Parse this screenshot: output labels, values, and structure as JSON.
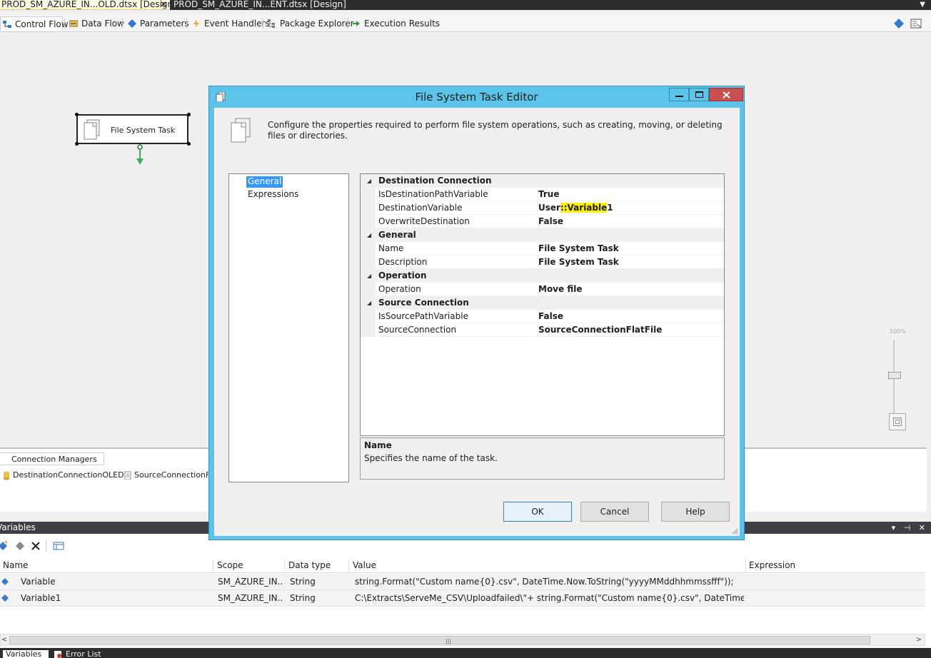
{
  "doc_tabs": [
    {
      "label": "PROD_SM_AZURE_IN...OLD.dtsx [Design]*",
      "close": "✕"
    },
    {
      "label": "PROD_SM_AZURE_IN...ENT.dtsx [Design]"
    }
  ],
  "doc_tabs_dropdown": "▼",
  "designer_tabs": [
    "Control Flow",
    "Data Flow",
    "Parameters",
    "Event Handlers",
    "Package Explorer",
    "Execution Results"
  ],
  "canvas": {
    "task_label": "File System Task",
    "zoom_label": "100%"
  },
  "connection_managers": {
    "tab_label": "Connection Managers",
    "items": [
      "DestinationConnectionOLEDB",
      "SourceConnectionFlatFile"
    ]
  },
  "variables_panel": {
    "title": "Variables",
    "title_controls": "▾ ⊣ ✕",
    "columns": [
      "Name",
      "Scope",
      "Data type",
      "Value",
      "Expression"
    ],
    "rows": [
      {
        "name": "Variable",
        "scope": "SM_AZURE_IN...",
        "type": "String",
        "value": "string.Format(\"Custom name{0}.csv\", DateTime.Now.ToString(\"yyyyMMddhhmmssfff\"));",
        "expression": ""
      },
      {
        "name": "Variable1",
        "scope": "SM_AZURE_IN...",
        "type": "String",
        "value": "C:\\Extracts\\ServeMe_CSV\\Uploadfailed\\\"+ string.Format(\"Custom name{0}.csv\", DateTime.Now.ToSt...",
        "expression": ""
      }
    ],
    "scroll_grip": "|||",
    "scroll_left": "<",
    "scroll_right": ">"
  },
  "bottom_tabs": [
    "Variables",
    "Error List"
  ],
  "dialog": {
    "title": "File System Task Editor",
    "description": "Configure the properties required to perform file system operations, such as creating, moving, or deleting files or directories.",
    "nav_items": [
      "General",
      "Expressions"
    ],
    "categories": [
      {
        "name": "Destination Connection",
        "props": [
          {
            "name": "IsDestinationPathVariable",
            "value": "True"
          },
          {
            "name": "DestinationVariable",
            "value_prefix": "User",
            "value_highlight": "::Variable",
            "value_suffix": "1"
          },
          {
            "name": "OverwriteDestination",
            "value": "False"
          }
        ]
      },
      {
        "name": "General",
        "props": [
          {
            "name": "Name",
            "value": "File System Task"
          },
          {
            "name": "Description",
            "value": "File System Task"
          }
        ]
      },
      {
        "name": "Operation",
        "props": [
          {
            "name": "Operation",
            "value": "Move file"
          }
        ]
      },
      {
        "name": "Source Connection",
        "props": [
          {
            "name": "IsSourcePathVariable",
            "value": "False"
          },
          {
            "name": "SourceConnection",
            "value": "SourceConnectionFlatFile"
          }
        ]
      }
    ],
    "collapse_glyph": "◢",
    "help_title": "Name",
    "help_text": "Specifies the name of the task.",
    "buttons": {
      "ok": "OK",
      "cancel": "Cancel",
      "help": "Help"
    },
    "window_controls": {
      "minimize": "—",
      "maximize": "☐",
      "close": "✕"
    }
  },
  "colors": {
    "dialog_frame": "#5bc4e8",
    "selection": "#3399ff",
    "highlight": "#fff200",
    "close_button": "#c75050"
  }
}
